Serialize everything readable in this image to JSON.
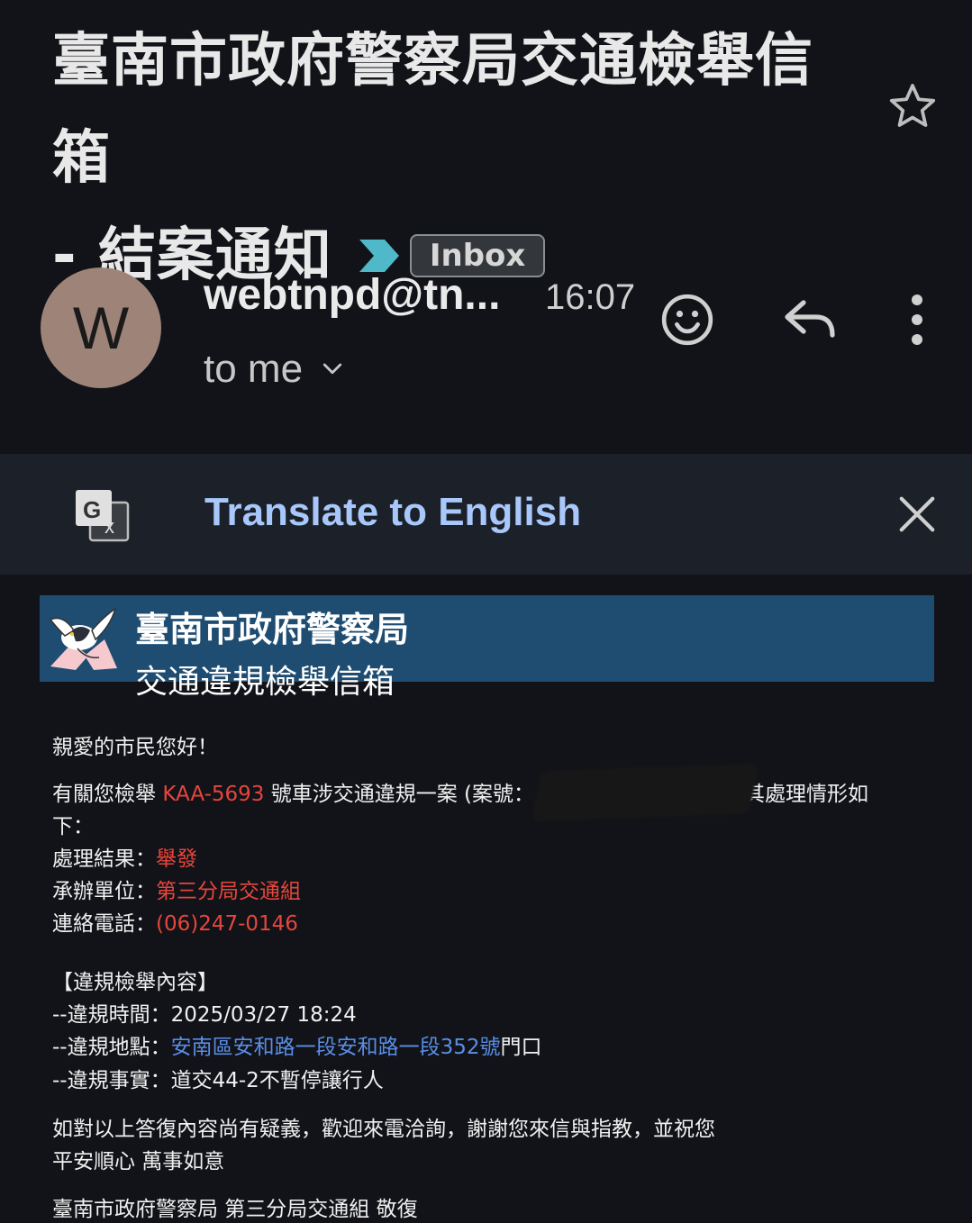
{
  "subject": {
    "line1": "臺南市政府警察局交通檢舉信箱",
    "line2": "- 結案通知",
    "label": "Inbox"
  },
  "sender": {
    "avatar_letter": "W",
    "name": "webtnpd@tn...",
    "time": "16:07",
    "recipient": "to me"
  },
  "translate": {
    "label": "Translate to English"
  },
  "email": {
    "banner_title": "臺南市政府警察局",
    "banner_sub": "交通違規檢舉信箱",
    "greeting": "親愛的市民您好！",
    "intro_prefix": "有關您檢舉",
    "plate": "KAA-5693",
    "intro_mid": "號車涉交通違規一案 (案號：",
    "intro_suffix": "，其處理情形如",
    "intro_line2": "下：",
    "result_label": "處理結果：",
    "result_value": "舉發",
    "unit_label": "承辦單位：",
    "unit_value": "第三分局交通組",
    "phone_label": "連絡電話：",
    "phone_value": "(06)247-0146",
    "section_title": "【違規檢舉內容】",
    "time_label": "--違規時間：",
    "time_value": "2025/03/27 18:24",
    "place_label": "--違規地點：",
    "place_value": "安南區安和路一段安和路一段352號",
    "place_suffix": "門口",
    "fact_label": "--違規事實：",
    "fact_value": "道交44-2不暫停讓行人",
    "closing_line1": "如對以上答復內容尚有疑義，歡迎來電洽詢，謝謝您來信與指教，並祝您",
    "closing_line2": "平安順心 萬事如意",
    "signature": "臺南市政府警察局 第三分局交通組 敬復"
  },
  "colors": {
    "background": "#111318",
    "translate_bar": "#1c2028",
    "translate_text": "#a8c7fa",
    "banner": "#1f4d72",
    "highlight_red": "#e8453c",
    "link_blue": "#5a8ee6",
    "importance_marker": "#4fb8c9"
  },
  "icons": [
    "star-icon",
    "importance-marker-icon",
    "smiley-icon",
    "reply-icon",
    "more-vert-icon",
    "chevron-down-icon",
    "google-translate-icon",
    "close-icon",
    "police-logo-icon"
  ]
}
